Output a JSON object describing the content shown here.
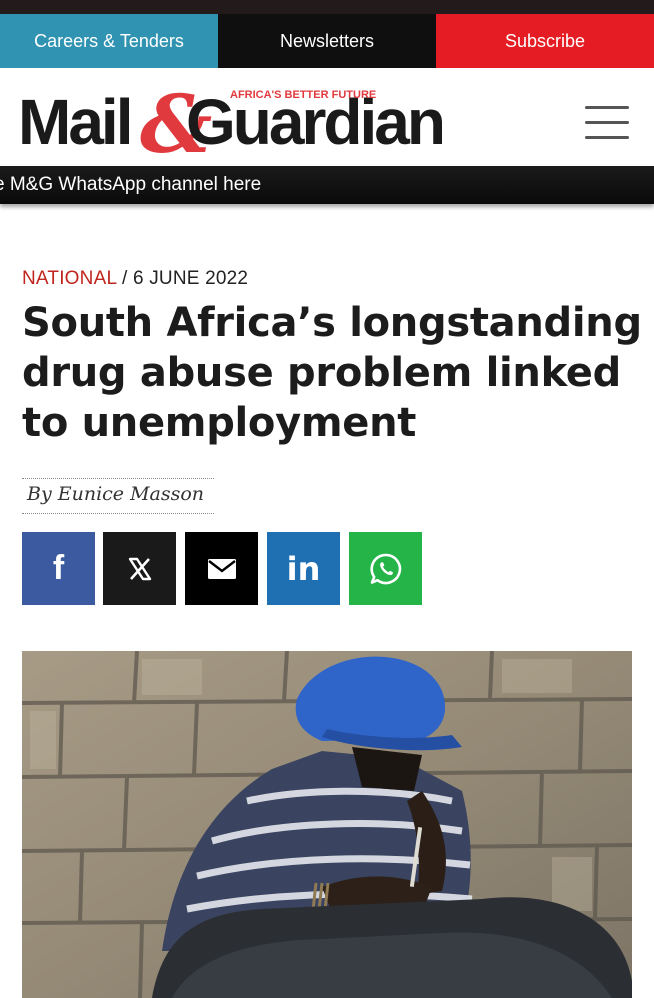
{
  "top_nav": {
    "careers_label": "Careers & Tenders",
    "newsletters_label": "Newsletters",
    "subscribe_label": "Subscribe"
  },
  "masthead": {
    "logo_text_left": "Mail",
    "logo_ampersand": "&",
    "logo_text_right": "Guardian",
    "tagline": "AFRICA'S BETTER FUTURE"
  },
  "ticker": {
    "text": "e M&G WhatsApp channel here"
  },
  "article": {
    "category": "NATIONAL",
    "separator": "/",
    "date": "6 JUNE 2022",
    "headline": "South Africa’s longstanding drug abuse problem linked to unemployment",
    "byline": "By Eunice Masson"
  },
  "share": {
    "facebook_icon": "facebook-icon",
    "x_icon": "x-icon",
    "email_icon": "envelope-icon",
    "linkedin_icon": "linkedin-icon",
    "whatsapp_icon": "whatsapp-icon",
    "facebook_glyph": "f",
    "x_glyph": "𝕏",
    "linkedin_glyph": "in"
  },
  "colors": {
    "careers_bg": "#2f93b1",
    "newsletters_bg": "#0f0f0f",
    "subscribe_bg": "#e51c23",
    "brand_red": "#e03a3e",
    "category_red": "#c0261e",
    "facebook_blue": "#3b5aa0",
    "linkedin_blue": "#1f6fb3",
    "whatsapp_green": "#25b447"
  }
}
